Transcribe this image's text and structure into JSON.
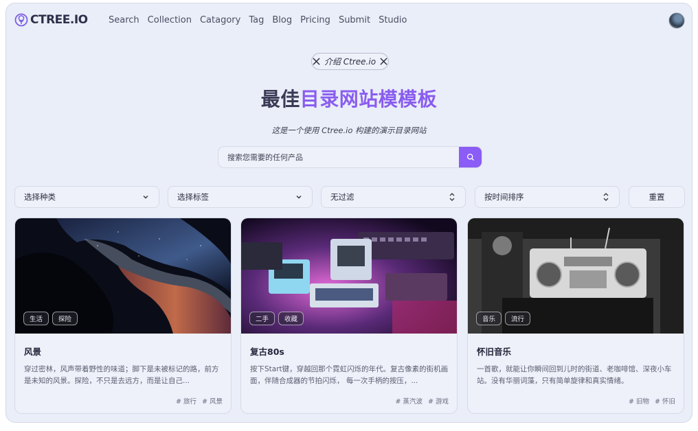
{
  "nav": {
    "logo_text": "CTREE.IO",
    "links": [
      "Search",
      "Collection",
      "Catagory",
      "Tag",
      "Blog",
      "Pricing",
      "Submit",
      "Studio"
    ]
  },
  "hero": {
    "pill_text": "介绍 Ctree.io",
    "title_part1": "最佳",
    "title_part2": "目录网站模模板",
    "subtitle": "这是一个使用 Ctree.io 构建的演示目录网站"
  },
  "search": {
    "placeholder": "搜索您需要的任何产品"
  },
  "filters": {
    "category": "选择种类",
    "tag": "选择标签",
    "filter": "无过滤",
    "sort": "按时间排序",
    "reset": "重置"
  },
  "cards": [
    {
      "tags": [
        "生活",
        "探险"
      ],
      "title": "风景",
      "description": "穿过密林，风声带着野性的味道；脚下是未被标记的路，前方是未知的风景。探险，不只是去远方，而是让自己...",
      "hashtags": [
        "# 旅行",
        "# 风景"
      ]
    },
    {
      "tags": [
        "二手",
        "收藏"
      ],
      "title": "复古80s",
      "description": "按下Start键，穿越回那个霓虹闪烁的年代。复古像素的街机画面，伴随合成器的节拍闪烁， 每一次手柄的按压，...",
      "hashtags": [
        "# 蒸汽波",
        "# 游戏"
      ]
    },
    {
      "tags": [
        "音乐",
        "流行"
      ],
      "title": "怀旧音乐",
      "description": "一首歌，就能让你瞬间回到儿时的街道、老咖啡馆、深夜小车站。没有华丽词藻，只有简单旋律和真实情绪。",
      "hashtags": [
        "# 旧物",
        "# 怀旧"
      ]
    }
  ],
  "colors": {
    "accent": "#8b5cf6",
    "background": "#e9eef8",
    "title_dark": "#3b3a55"
  }
}
